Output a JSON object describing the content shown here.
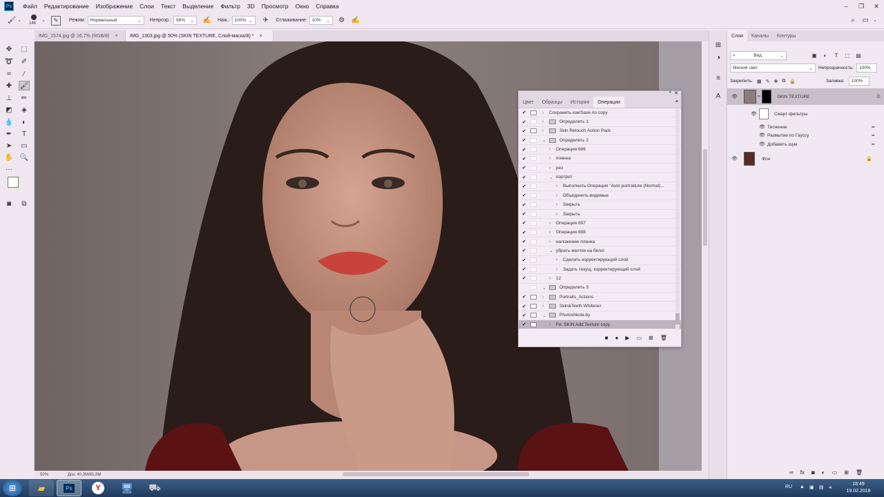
{
  "menu": {
    "logo": "Ps",
    "items": [
      "Файл",
      "Редактирование",
      "Изображение",
      "Слои",
      "Текст",
      "Выделение",
      "Фильтр",
      "3D",
      "Просмотр",
      "Окно",
      "Справка"
    ]
  },
  "options": {
    "brush_size": "146",
    "mode_label": "Режим:",
    "mode_value": "Нормальный",
    "opacity_label": "Непрозр.:",
    "opacity_value": "58%",
    "pressure_label": "Наж.:",
    "pressure_value": "100%",
    "smoothing_label": "Сглаживание:",
    "smoothing_value": "10%"
  },
  "doc_tabs": [
    {
      "label": "IMG_1574.jpg @ 16,7% (RGB/8)",
      "close": "×"
    },
    {
      "label": "IMG_1303.jpg @ 50% (SKIN TEXTURE, Слой-маска/8) *",
      "close": "×"
    }
  ],
  "status": {
    "zoom": "50%",
    "doc": "Док: 40,3M/81,8M"
  },
  "layers_panel": {
    "tabs": [
      "Слои",
      "Каналы",
      "Контуры"
    ],
    "filter": "Вид",
    "blend_mode": "Мягкий свет",
    "opacity_label": "Непрозрачность:",
    "opacity_value": "100%",
    "lock_label": "Закрепить:",
    "fill_label": "Заливка:",
    "fill_value": "100%",
    "layers": {
      "skin": "SKIN TEXTURE",
      "smart_filters": "Смарт-фильтры",
      "filter1": "Тиснение",
      "filter2": "Размытие по Гауссу",
      "filter3": "Добавить шум",
      "bg": "Фон"
    }
  },
  "actions_panel": {
    "tabs": [
      "Цвет",
      "Образцы",
      "История",
      "Операции"
    ],
    "rows": [
      {
        "label": "Сохранить как/Save As copy",
        "checked": true,
        "dialog": true,
        "indent": 0,
        "type": "step"
      },
      {
        "label": "Определить 1",
        "checked": true,
        "dialog": false,
        "indent": 0,
        "type": "set"
      },
      {
        "label": "Skin Retouch Action Pack",
        "checked": true,
        "dialog": true,
        "indent": 0,
        "type": "set"
      },
      {
        "label": "Определить 2",
        "checked": true,
        "dialog": false,
        "indent": 0,
        "type": "set-open"
      },
      {
        "label": "Операция 696",
        "checked": true,
        "dialog": false,
        "indent": 1,
        "type": "action"
      },
      {
        "label": "пленка",
        "checked": true,
        "dialog": false,
        "indent": 1,
        "type": "action"
      },
      {
        "label": "рез",
        "checked": true,
        "dialog": false,
        "indent": 1,
        "type": "action"
      },
      {
        "label": "портрет",
        "checked": true,
        "dialog": false,
        "indent": 1,
        "type": "action-open"
      },
      {
        "label": "Выполнить Операция \"Auto portraiture (Normal)...",
        "checked": true,
        "dialog": false,
        "indent": 2,
        "type": "step"
      },
      {
        "label": "Объединить видимые",
        "checked": true,
        "dialog": false,
        "indent": 2,
        "type": "step"
      },
      {
        "label": "Закрыть",
        "checked": true,
        "dialog": false,
        "indent": 2,
        "type": "step-arrow"
      },
      {
        "label": "Закрыть",
        "checked": true,
        "dialog": false,
        "indent": 2,
        "type": "step-arrow"
      },
      {
        "label": "Операция 697",
        "checked": true,
        "dialog": false,
        "indent": 1,
        "type": "action"
      },
      {
        "label": "Операция 698",
        "checked": true,
        "dialog": false,
        "indent": 1,
        "type": "action"
      },
      {
        "label": "наложение пленка",
        "checked": true,
        "dialog": false,
        "indent": 1,
        "type": "action"
      },
      {
        "label": "убрать желток на бело\\",
        "checked": true,
        "dialog": false,
        "indent": 1,
        "type": "action-open"
      },
      {
        "label": "Сделать корректирующий слой",
        "checked": true,
        "dialog": false,
        "indent": 2,
        "type": "step-arrow"
      },
      {
        "label": "Задать текущ. корректирующий слой",
        "checked": true,
        "dialog": false,
        "indent": 2,
        "type": "step-arrow"
      },
      {
        "label": "12",
        "checked": true,
        "dialog": false,
        "indent": 1,
        "type": "action"
      },
      {
        "label": "Определить 3",
        "checked": false,
        "dialog": false,
        "indent": 0,
        "type": "set-open"
      },
      {
        "label": "Portraits_Actions",
        "checked": true,
        "dialog": true,
        "indent": 0,
        "type": "set"
      },
      {
        "label": "Skin&Teeth Whitener",
        "checked": true,
        "dialog": true,
        "indent": 0,
        "type": "set"
      },
      {
        "label": "Photoshkola.by",
        "checked": true,
        "dialog": true,
        "indent": 0,
        "type": "set-open"
      },
      {
        "label": "FA: SKIN Add Texture copy",
        "checked": true,
        "dialog": true,
        "indent": 1,
        "type": "selected"
      }
    ]
  },
  "taskbar": {
    "lang": "RU",
    "time": "18:49",
    "date": "19.02.2018"
  }
}
